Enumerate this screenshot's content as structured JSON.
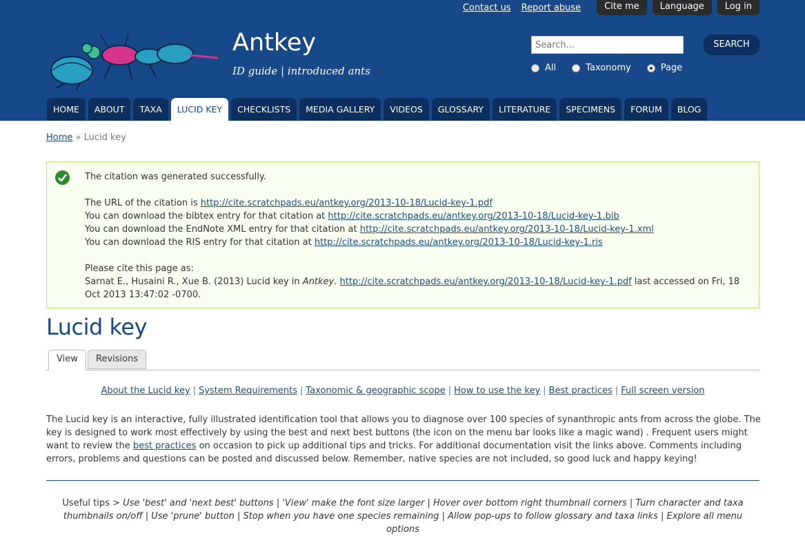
{
  "top_links": {
    "contact": "Contact us",
    "report": "Report abuse",
    "cite": "Cite me",
    "language": "Language",
    "login": "Log in"
  },
  "site": {
    "name": "Antkey",
    "slogan": "ID guide | introduced ants"
  },
  "search": {
    "placeholder": "Search...",
    "button": "SEARCH",
    "options": [
      "All",
      "Taxonomy",
      "Page"
    ],
    "selected": "Page"
  },
  "nav": [
    "HOME",
    "ABOUT",
    "TAXA",
    "LUCID KEY",
    "CHECKLISTS",
    "MEDIA GALLERY",
    "VIDEOS",
    "GLOSSARY",
    "LITERATURE",
    "SPECIMENS",
    "FORUM",
    "BLOG"
  ],
  "nav_active": "LUCID KEY",
  "breadcrumb": {
    "home": "Home",
    "sep": "»",
    "current": "Lucid key"
  },
  "message": {
    "success": "The citation was generated successfully.",
    "url_prefix": "The URL of the citation is ",
    "url": "http://cite.scratchpads.eu/antkey.org/2013-10-18/Lucid-key-1.pdf",
    "bibtex_prefix": "You can download the bibtex entry for that citation at ",
    "bibtex": "http://cite.scratchpads.eu/antkey.org/2013-10-18/Lucid-key-1.bib",
    "endnote_prefix": "You can download the EndNote XML entry for that citation at ",
    "endnote": "http://cite.scratchpads.eu/antkey.org/2013-10-18/Lucid-key-1.xml",
    "ris_prefix": "You can download the RIS entry for that citation at ",
    "ris": "http://cite.scratchpads.eu/antkey.org/2013-10-18/Lucid-key-1.ris",
    "cite_as": "Please cite this page as:",
    "authors": "Sarnat E., Husaini R., Xue B. (2013) Lucid key in ",
    "journal": "Antkey",
    "period": ". ",
    "cite_link": "http://cite.scratchpads.eu/antkey.org/2013-10-18/Lucid-key-1.pdf",
    "accessed": " last accessed on Fri, 18 Oct 2013 13:47:02 -0700."
  },
  "page_title": "Lucid key",
  "tabs": [
    "View",
    "Revisions"
  ],
  "links": [
    "About the Lucid key",
    "System Requirements",
    "Taxonomic & geographic scope",
    "How to use the key",
    "Best practices",
    "Full screen version"
  ],
  "link_sep": "|",
  "intro": {
    "part1": "The Lucid key is an interactive, fully illustrated identification tool that allows you to diagnose over 100 species of synanthropic ants from across the globe. The key is designed to work most effectively by using the best and next best buttons (the icon on the menu bar looks like a magic wand) . Frequent users might want to review the ",
    "link": "best practices",
    "part2": " on occasion to pick up additional tips and tricks. For additional documentation visit the links above. Comments including errors, problems and questions can be posted and discussed below. Remember, native species are not included, so good luck and happy keying!"
  },
  "tips": {
    "lead": "Useful tips > ",
    "text": "Use 'best' and 'next best' buttons | 'View' make the font size larger | Hover over bottom right thumbnail corners | Turn character and taxa thumbnails on/off | Use 'prune' button | Stop when you have one species remaining | Allow pop-ups to follow glossary and taxa links | Explore all menu options"
  },
  "colors": {
    "header": "#17498a",
    "nav_tab": "#0c2f5f",
    "success_bg": "#f8fff0",
    "success_border": "#bbee77"
  }
}
